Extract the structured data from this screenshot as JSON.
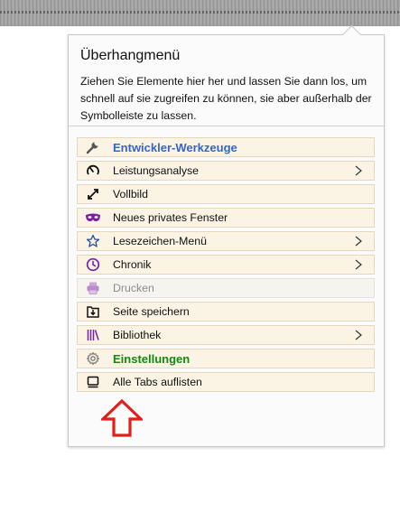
{
  "panel": {
    "title": "Überhangmenü",
    "description": "Ziehen Sie Elemente hier her und lassen Sie dann los, um schnell auf sie zugreifen zu können, sie aber außerhalb der Symbolleiste zu lassen."
  },
  "items": [
    {
      "label": "Entwickler-Werkzeuge",
      "icon": "wrench-icon",
      "submenu": false,
      "style": "bold-blue"
    },
    {
      "label": "Leistungsanalyse",
      "icon": "stopwatch-icon",
      "submenu": true
    },
    {
      "label": "Vollbild",
      "icon": "fullscreen-icon",
      "submenu": false
    },
    {
      "label": "Neues privates Fenster",
      "icon": "private-mask-icon",
      "submenu": false
    },
    {
      "label": "Lesezeichen-Menü",
      "icon": "bookmark-star-icon",
      "submenu": true
    },
    {
      "label": "Chronik",
      "icon": "clock-icon",
      "submenu": true
    },
    {
      "label": "Drucken",
      "icon": "printer-icon",
      "submenu": false,
      "disabled": true
    },
    {
      "label": "Seite speichern",
      "icon": "save-page-icon",
      "submenu": false
    },
    {
      "label": "Bibliothek",
      "icon": "library-icon",
      "submenu": true
    },
    {
      "label": "Einstellungen",
      "icon": "gear-icon",
      "submenu": false,
      "style": "bold-green"
    },
    {
      "label": "Alle Tabs auflisten",
      "icon": "tabs-list-icon",
      "submenu": false
    }
  ],
  "colors": {
    "item_bg": "#fbf3e3",
    "devtools_text": "#3366cc",
    "settings_text": "#128a12",
    "annotation_arrow": "#e0201a",
    "private_icon": "#7a1fa2"
  },
  "annotation": {
    "icon": "red-up-arrow-icon"
  }
}
